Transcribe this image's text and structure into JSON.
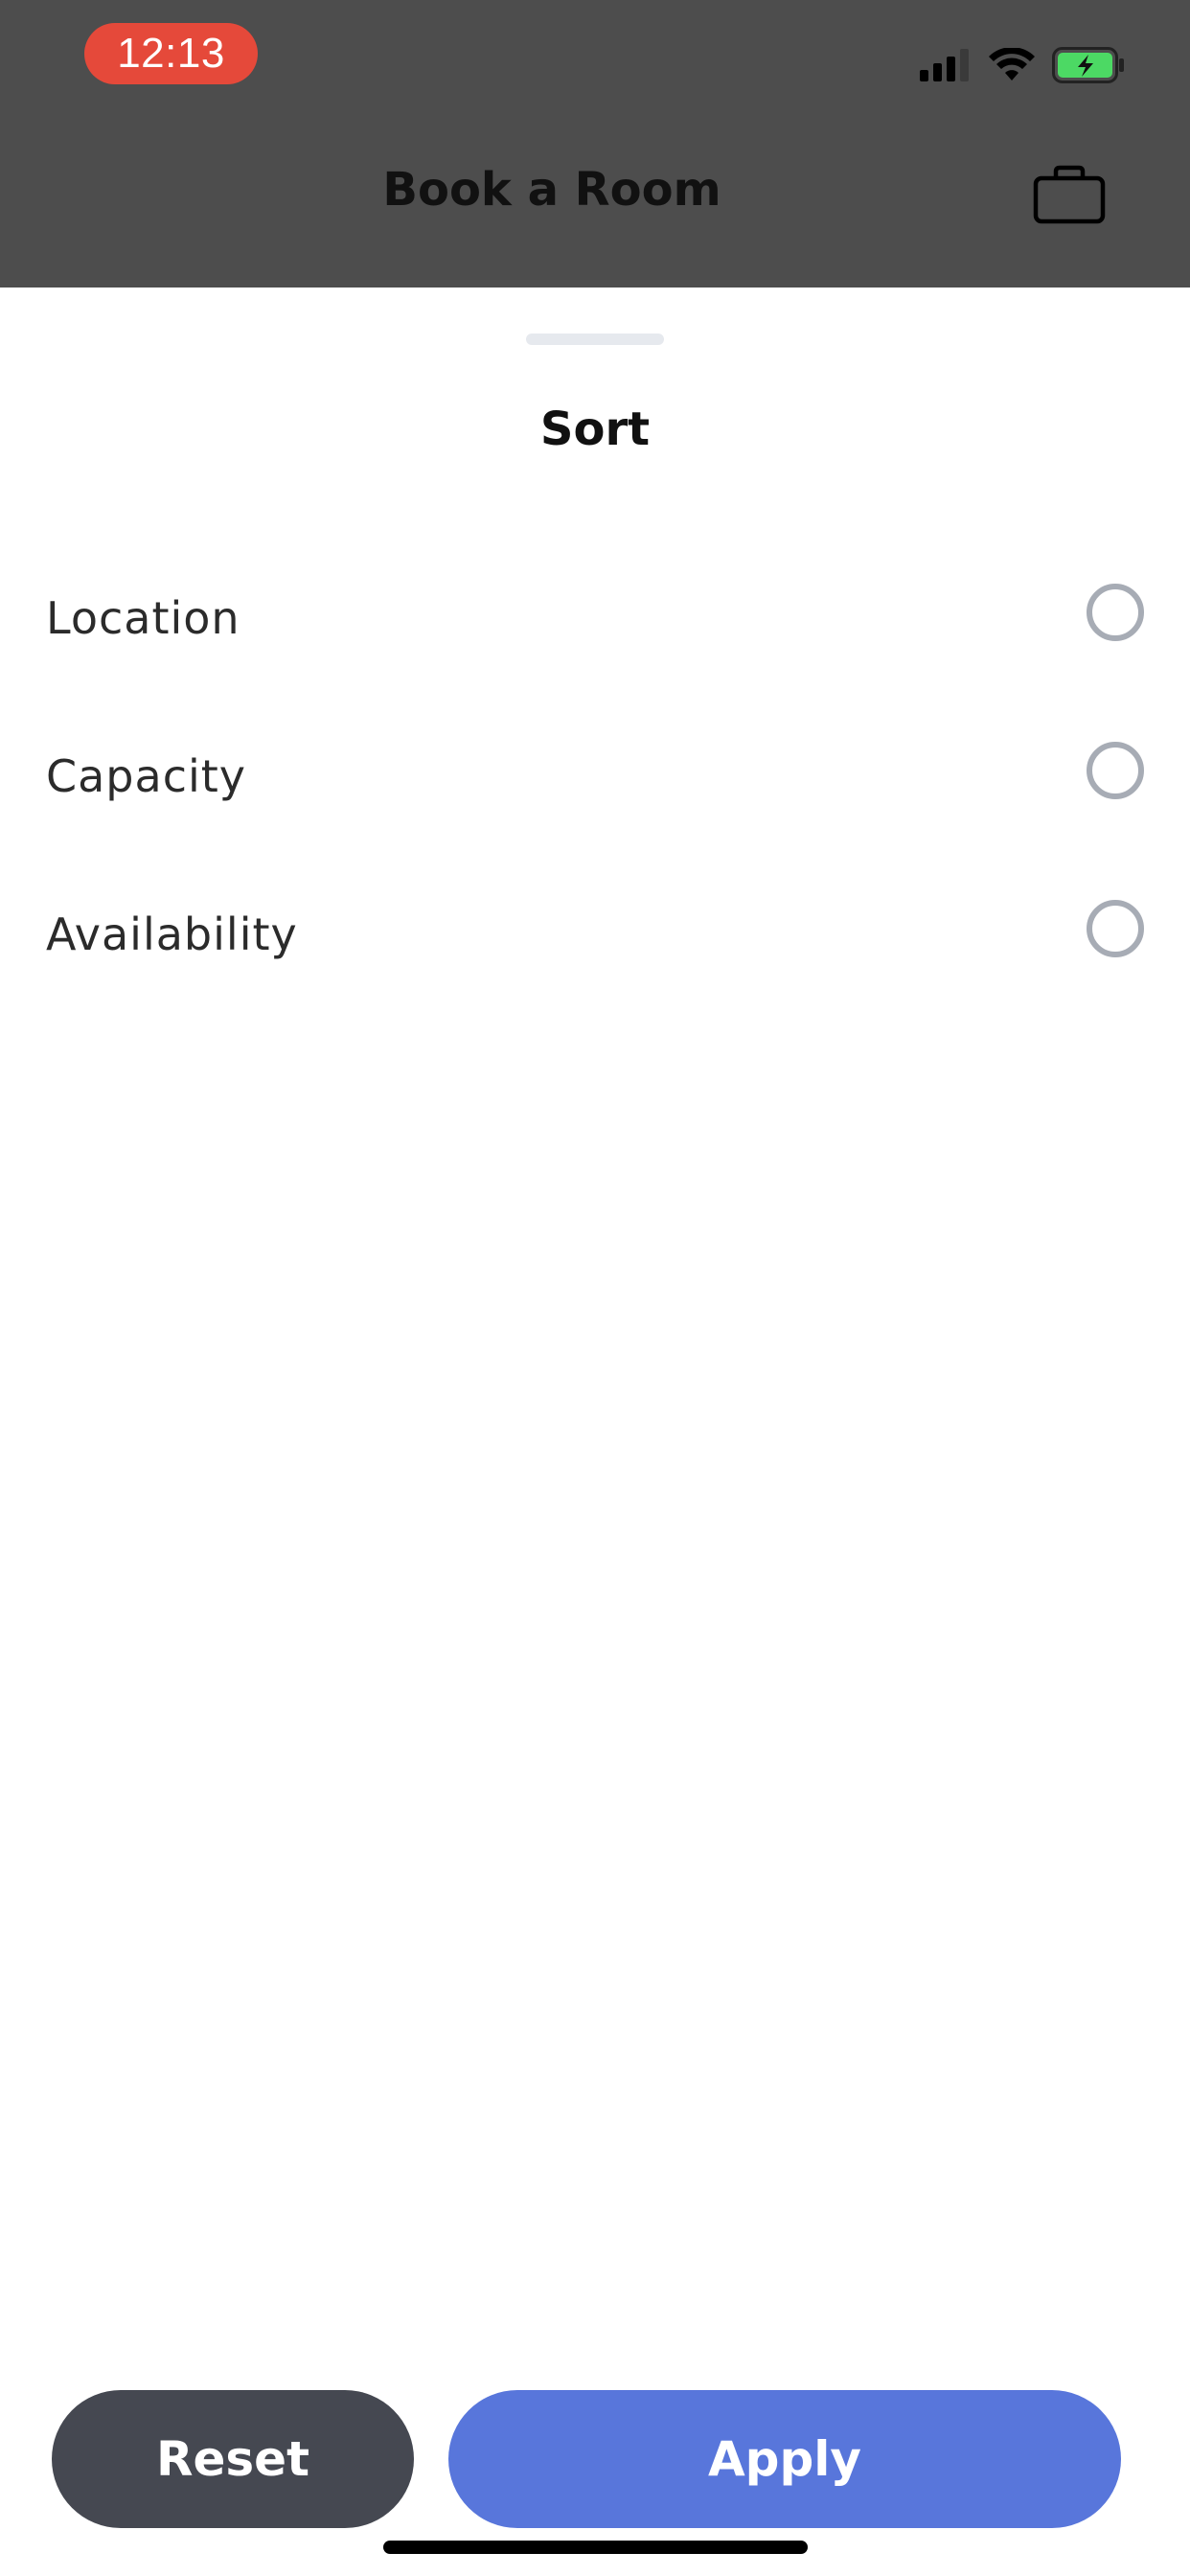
{
  "status_bar": {
    "time": "12:13",
    "time_pill_color": "#e5493a",
    "icons": [
      "cellular-signal-icon",
      "wifi-icon",
      "battery-charging-icon"
    ],
    "battery_fill_color": "#4cd964"
  },
  "nav": {
    "title": "Book a Room",
    "right_icon": "briefcase-icon"
  },
  "sheet": {
    "title": "Sort",
    "options": [
      {
        "label": "Location",
        "selected": false
      },
      {
        "label": "Capacity",
        "selected": false
      },
      {
        "label": "Availability",
        "selected": false
      }
    ]
  },
  "actions": {
    "reset_label": "Reset",
    "apply_label": "Apply",
    "reset_color": "#454851",
    "apply_color": "#5876db"
  },
  "colors": {
    "dimmed_header": "#4d4d4d",
    "radio_border": "#a7acb5"
  }
}
